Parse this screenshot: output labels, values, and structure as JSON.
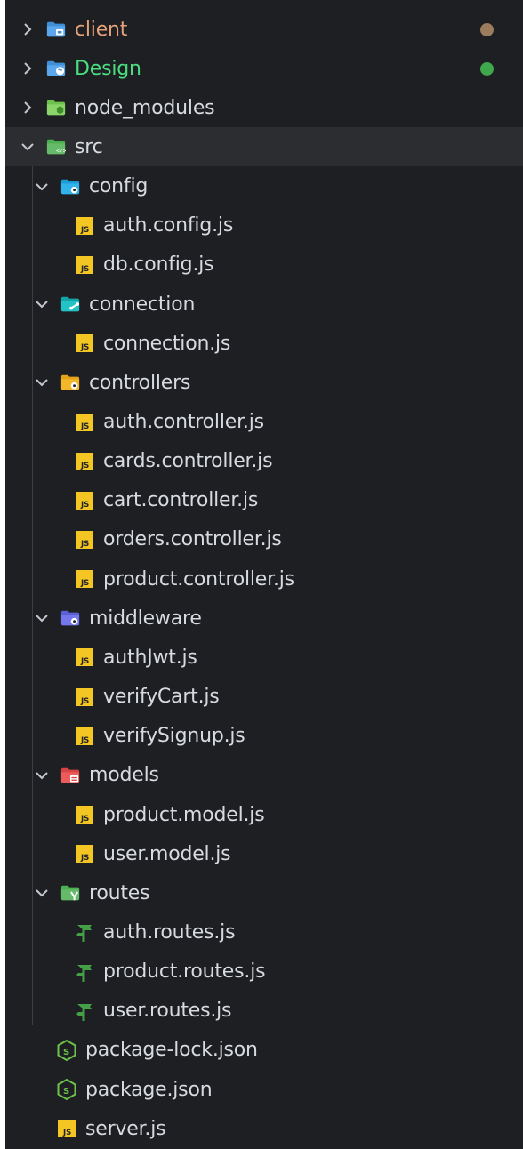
{
  "colors": {
    "background": "#1e1f22",
    "selected_row": "#2b2d31",
    "text": "#d7dae0",
    "git_modified": "#e5a27a",
    "git_untracked": "#4ade80",
    "modified_dot": "#9d7b5d",
    "untracked_dot": "#3fa84d",
    "js_badge": "#f3c623",
    "route_icon": "#43a047"
  },
  "tree": {
    "items": [
      {
        "label": "client",
        "depth": 0,
        "type": "folder",
        "expanded": false,
        "icon": "client-folder-icon",
        "status": "modified"
      },
      {
        "label": "Design",
        "depth": 0,
        "type": "folder",
        "expanded": false,
        "icon": "design-folder-icon",
        "status": "untracked"
      },
      {
        "label": "node_modules",
        "depth": 0,
        "type": "folder",
        "expanded": false,
        "icon": "node-modules-folder-icon"
      },
      {
        "label": "src",
        "depth": 0,
        "type": "folder",
        "expanded": true,
        "selected": true,
        "icon": "src-folder-icon"
      },
      {
        "label": "config",
        "depth": 1,
        "type": "folder",
        "expanded": true,
        "icon": "config-folder-icon"
      },
      {
        "label": "auth.config.js",
        "depth": 2,
        "type": "file",
        "icon": "js-file-icon"
      },
      {
        "label": "db.config.js",
        "depth": 2,
        "type": "file",
        "icon": "js-file-icon"
      },
      {
        "label": "connection",
        "depth": 1,
        "type": "folder",
        "expanded": true,
        "icon": "connection-folder-icon"
      },
      {
        "label": "connection.js",
        "depth": 2,
        "type": "file",
        "icon": "js-file-icon"
      },
      {
        "label": "controllers",
        "depth": 1,
        "type": "folder",
        "expanded": true,
        "icon": "controllers-folder-icon"
      },
      {
        "label": "auth.controller.js",
        "depth": 2,
        "type": "file",
        "icon": "js-file-icon"
      },
      {
        "label": "cards.controller.js",
        "depth": 2,
        "type": "file",
        "icon": "js-file-icon"
      },
      {
        "label": "cart.controller.js",
        "depth": 2,
        "type": "file",
        "icon": "js-file-icon"
      },
      {
        "label": "orders.controller.js",
        "depth": 2,
        "type": "file",
        "icon": "js-file-icon"
      },
      {
        "label": "product.controller.js",
        "depth": 2,
        "type": "file",
        "icon": "js-file-icon"
      },
      {
        "label": "middleware",
        "depth": 1,
        "type": "folder",
        "expanded": true,
        "icon": "middleware-folder-icon"
      },
      {
        "label": "authJwt.js",
        "depth": 2,
        "type": "file",
        "icon": "js-file-icon"
      },
      {
        "label": "verifyCart.js",
        "depth": 2,
        "type": "file",
        "icon": "js-file-icon"
      },
      {
        "label": "verifySignup.js",
        "depth": 2,
        "type": "file",
        "icon": "js-file-icon"
      },
      {
        "label": "models",
        "depth": 1,
        "type": "folder",
        "expanded": true,
        "icon": "models-folder-icon"
      },
      {
        "label": "product.model.js",
        "depth": 2,
        "type": "file",
        "icon": "js-file-icon"
      },
      {
        "label": "user.model.js",
        "depth": 2,
        "type": "file",
        "icon": "js-file-icon"
      },
      {
        "label": "routes",
        "depth": 1,
        "type": "folder",
        "expanded": true,
        "icon": "routes-folder-icon"
      },
      {
        "label": "auth.routes.js",
        "depth": 2,
        "type": "file",
        "icon": "route-file-icon"
      },
      {
        "label": "product.routes.js",
        "depth": 2,
        "type": "file",
        "icon": "route-file-icon"
      },
      {
        "label": "user.routes.js",
        "depth": 2,
        "type": "file",
        "icon": "route-file-icon"
      },
      {
        "label": "package-lock.json",
        "depth": 0,
        "type": "file",
        "icon": "nodejs-file-icon"
      },
      {
        "label": "package.json",
        "depth": 0,
        "type": "file",
        "icon": "nodejs-file-icon"
      },
      {
        "label": "server.js",
        "depth": 0,
        "type": "file",
        "icon": "js-file-icon"
      }
    ]
  }
}
